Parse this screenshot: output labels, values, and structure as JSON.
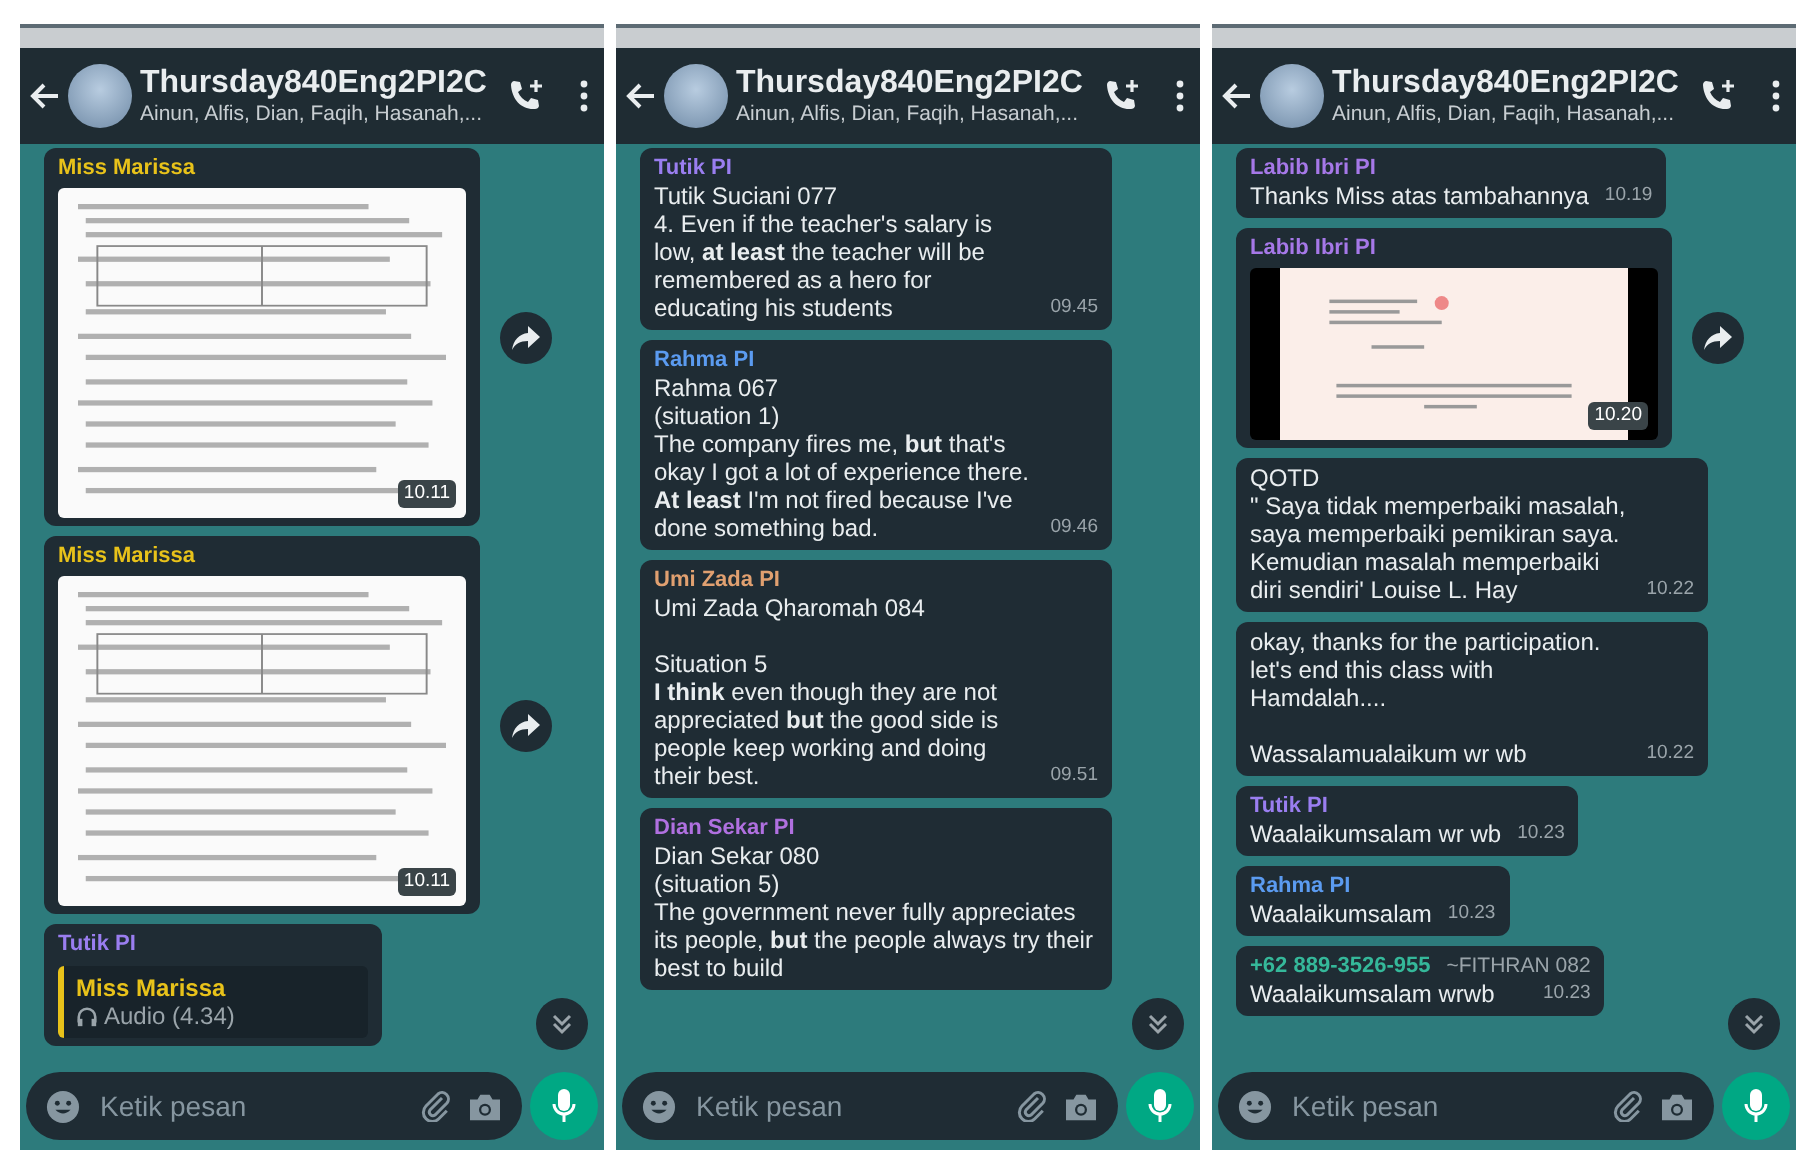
{
  "panels": [
    {
      "header": {
        "title": "Thursday840Eng2PI2C",
        "subtitle": "Ainun, Alfis, Dian, Faqih, Hasanah,..."
      },
      "messages": [
        {
          "kind": "image",
          "sender": "Miss Marissa",
          "color": "#e8c21a",
          "time": "10.11",
          "forward": true
        },
        {
          "kind": "image",
          "sender": "Miss Marissa",
          "color": "#e8c21a",
          "time": "10.11",
          "forward": true
        },
        {
          "kind": "reply",
          "sender": "Tutik PI",
          "color": "#9a7ef0",
          "quote_sender": "Miss Marissa",
          "quote_body": "Audio (4.34)",
          "forward": false
        }
      ],
      "input": {
        "placeholder": "Ketik pesan"
      }
    },
    {
      "header": {
        "title": "Thursday840Eng2PI2C",
        "subtitle": "Ainun, Alfis, Dian, Faqih, Hasanah,..."
      },
      "messages": [
        {
          "kind": "text",
          "sender": "Tutik PI",
          "color": "#9a7ef0",
          "body": "Tutik Suciani 077\n4. Even if the teacher's salary is low, **at least** the teacher will be remembered as a hero for educating his students",
          "time": "09.45",
          "forward": false
        },
        {
          "kind": "text",
          "sender": "Rahma PI",
          "color": "#5b9bf0",
          "body": "Rahma 067\n(situation 1)\nThe company fires me, **but** that's okay I got a lot of experience there. **At least** I'm not fired because I've done something bad.",
          "time": "09.46",
          "forward": false
        },
        {
          "kind": "text",
          "sender": "Umi Zada PI",
          "color": "#e0a070",
          "body": "Umi Zada Qharomah 084\n\nSituation 5\n**I think** even though they are not appreciated **but** the good side is people keep working and doing their best.",
          "time": "09.51",
          "forward": false
        },
        {
          "kind": "text",
          "sender": "Dian Sekar PI",
          "color": "#b070e0",
          "body": "Dian Sekar 080\n(situation 5)\nThe government never fully appreciates its people, **but** the people always try their best to build",
          "forward": false
        }
      ],
      "input": {
        "placeholder": "Ketik pesan"
      }
    },
    {
      "header": {
        "title": "Thursday840Eng2PI2C",
        "subtitle": "Ainun, Alfis, Dian, Faqih, Hasanah,..."
      },
      "messages": [
        {
          "kind": "text",
          "sender": "Labib Ibri PI",
          "color": "#a678e8",
          "body": "Thanks Miss atas tambahannya",
          "time": "10.19",
          "forward": false
        },
        {
          "kind": "quote_image",
          "sender": "Labib Ibri PI",
          "color": "#a678e8",
          "time": "10.20",
          "forward": true
        },
        {
          "kind": "text",
          "body": "QOTD\n\" Saya tidak memperbaiki masalah, saya memperbaiki pemikiran saya. Kemudian masalah memperbaiki diri sendiri' Louise L. Hay",
          "time": "10.22",
          "forward": false
        },
        {
          "kind": "text",
          "body": "okay, thanks for the participation.\nlet's end this class with Hamdalah....\n\nWassalamualaikum wr wb",
          "time": "10.22",
          "forward": false
        },
        {
          "kind": "text",
          "sender": "Tutik PI",
          "color": "#9a7ef0",
          "body": "Waalaikumsalam wr wb",
          "time": "10.23",
          "forward": false
        },
        {
          "kind": "text",
          "sender": "Rahma PI",
          "color": "#5b9bf0",
          "body": "Waalaikumsalam",
          "time": "10.23",
          "forward": false
        },
        {
          "kind": "text",
          "sender": "+62 889-3526-955",
          "push_name": "~FITHRAN 082",
          "color": "#35b89a",
          "body": "Waalaikumsalam wrwb",
          "time": "10.23",
          "forward": false
        }
      ],
      "input": {
        "placeholder": "Ketik pesan"
      }
    }
  ]
}
